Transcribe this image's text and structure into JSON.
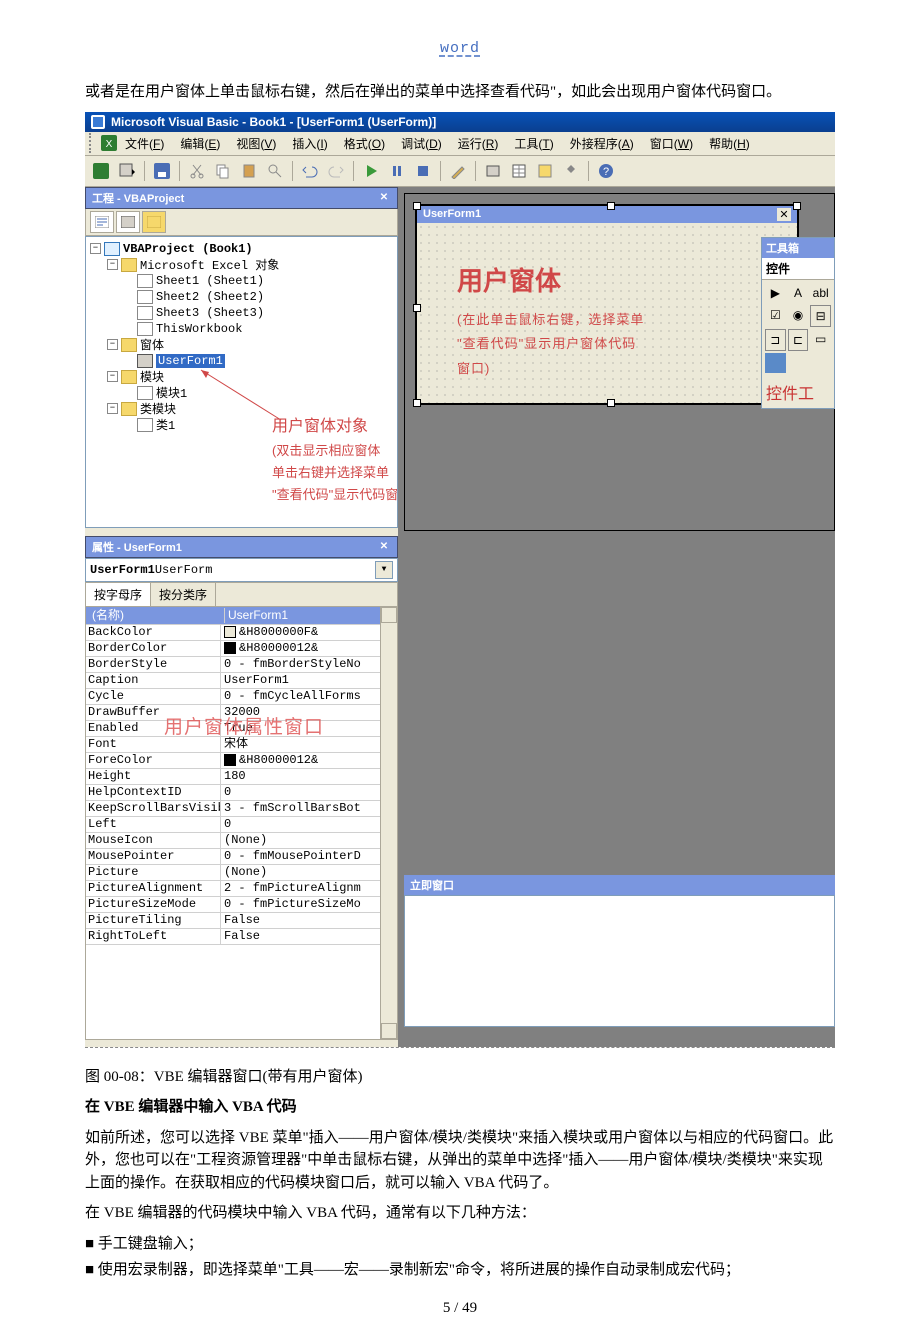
{
  "doc": {
    "header": "word",
    "intro_para": "或者是在用户窗体上单击鼠标右键，然后在弹出的菜单中选择查看代码\"，如此会出现用户窗体代码窗口。",
    "caption": "图 00-08：VBE 编辑器窗口(带有用户窗体)",
    "heading": "在 VBE 编辑器中输入 VBA 代码",
    "para1": "如前所述，您可以选择 VBE 菜单\"插入——用户窗体/模块/类模块\"来插入模块或用户窗体以与相应的代码窗口。此外，您也可以在\"工程资源管理器\"中单击鼠标右键，从弹出的菜单中选择\"插入——用户窗体/模块/类模块\"来实现上面的操作。在获取相应的代码模块窗口后，就可以输入 VBA 代码了。",
    "para2": "在 VBE 编辑器的代码模块中输入 VBA 代码，通常有以下几种方法：",
    "bullet1": "■ 手工键盘输入；",
    "bullet2": "■ 使用宏录制器，即选择菜单\"工具——宏——录制新宏\"命令，将所进展的操作自动录制成宏代码；",
    "page_num": "5 / 49"
  },
  "ide": {
    "title": "Microsoft Visual Basic - Book1 - [UserForm1 (UserForm)]",
    "menus": [
      {
        "label": "文件",
        "key": "F"
      },
      {
        "label": "编辑",
        "key": "E"
      },
      {
        "label": "视图",
        "key": "V"
      },
      {
        "label": "插入",
        "key": "I"
      },
      {
        "label": "格式",
        "key": "O"
      },
      {
        "label": "调试",
        "key": "D"
      },
      {
        "label": "运行",
        "key": "R"
      },
      {
        "label": "工具",
        "key": "T"
      },
      {
        "label": "外接程序",
        "key": "A"
      },
      {
        "label": "窗口",
        "key": "W"
      },
      {
        "label": "帮助",
        "key": "H"
      }
    ],
    "project_title": "工程 - VBAProject",
    "tree": {
      "root": "VBAProject (Book1)",
      "excel_objects": "Microsoft Excel 对象",
      "sheets": [
        "Sheet1 (Sheet1)",
        "Sheet2 (Sheet2)",
        "Sheet3 (Sheet3)"
      ],
      "thisworkbook": "ThisWorkbook",
      "forms_folder": "窗体",
      "userform": "UserForm1",
      "modules_folder": "模块",
      "module1": "模块1",
      "classmod_folder": "类模块",
      "class1": "类1"
    },
    "annotation": {
      "title": "用户窗体对象",
      "line1": "(双击显示相应窗体",
      "line2": "单击右键并选择菜单",
      "line3": "\"查看代码\"显示代码窗口 )"
    },
    "prop_title": "属性 - UserForm1",
    "prop_object": "UserForm1",
    "prop_class": " UserForm",
    "prop_tab1": "按字母序",
    "prop_tab2": "按分类序",
    "prop_header": "(名称)",
    "prop_header_val": "UserForm1",
    "prop_overlay": "用户窗体属性窗口",
    "props": [
      {
        "k": "BackColor",
        "v": "&H8000000F&",
        "c": "#ece9d8"
      },
      {
        "k": "BorderColor",
        "v": "&H80000012&",
        "c": "#000"
      },
      {
        "k": "BorderStyle",
        "v": "0 - fmBorderStyleNo"
      },
      {
        "k": "Caption",
        "v": "UserForm1"
      },
      {
        "k": "Cycle",
        "v": "0 - fmCycleAllForms"
      },
      {
        "k": "DrawBuffer",
        "v": "32000"
      },
      {
        "k": "Enabled",
        "v": "True"
      },
      {
        "k": "Font",
        "v": "宋体"
      },
      {
        "k": "ForeColor",
        "v": "&H80000012&",
        "c": "#000"
      },
      {
        "k": "Height",
        "v": "180"
      },
      {
        "k": "HelpContextID",
        "v": "0"
      },
      {
        "k": "KeepScrollBarsVisibl",
        "v": "3 - fmScrollBarsBot"
      },
      {
        "k": "Left",
        "v": "0"
      },
      {
        "k": "MouseIcon",
        "v": "(None)"
      },
      {
        "k": "MousePointer",
        "v": "0 - fmMousePointerD"
      },
      {
        "k": "Picture",
        "v": "(None)"
      },
      {
        "k": "PictureAlignment",
        "v": "2 - fmPictureAlignm"
      },
      {
        "k": "PictureSizeMode",
        "v": "0 - fmPictureSizeMo"
      },
      {
        "k": "PictureTiling",
        "v": "False"
      },
      {
        "k": "RightToLeft",
        "v": "False"
      }
    ],
    "userform_caption": "UserForm1",
    "uf_ann": {
      "big": "用户窗体",
      "l1": "(在此单击鼠标右键，选择菜单",
      "l2": "\"查看代码\"显示用户窗体代码",
      "l3": "窗口)"
    },
    "toolbox_title": "工具箱",
    "toolbox_tab": "控件",
    "toolbox_label": "控件工",
    "immediate_title": "立即窗口"
  }
}
